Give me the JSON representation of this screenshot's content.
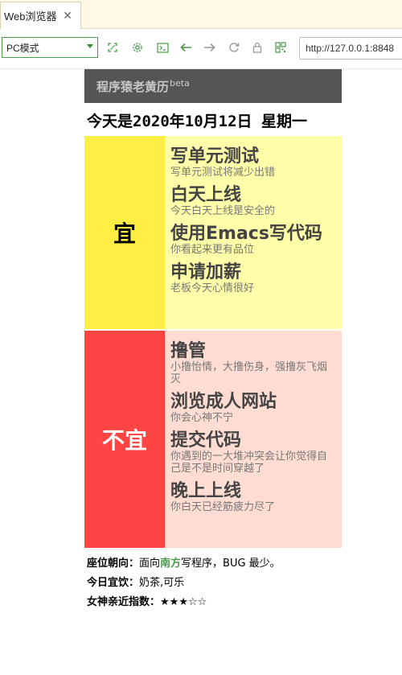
{
  "browser": {
    "tab": {
      "title": "Web浏览器",
      "close_glyph": "✕"
    },
    "mode_select": {
      "value": "PC模式"
    },
    "toolbar_icons": [
      "screenshot-icon",
      "settings-icon",
      "console-icon",
      "back-arrow-icon",
      "forward-arrow-icon",
      "reload-icon",
      "lock-icon",
      "qrcode-icon"
    ],
    "url": "http://127.0.0.1:8848",
    "accent_color": "#4a9a4a"
  },
  "page": {
    "header": {
      "title": "程序猿老黄历",
      "badge": "beta"
    },
    "date_line": "今天是2020年10月12日 星期一",
    "good": {
      "label": "宜",
      "color": "#ffee44",
      "items": [
        {
          "name": "写单元测试",
          "desc": "写单元测试将减少出错"
        },
        {
          "name": "白天上线",
          "desc": "今天白天上线是安全的"
        },
        {
          "name": "使用Emacs写代码",
          "desc": "你看起来更有品位"
        },
        {
          "name": "申请加薪",
          "desc": "老板今天心情很好"
        }
      ]
    },
    "bad": {
      "label": "不宜",
      "color": "#ff4444",
      "items": [
        {
          "name": "撸管",
          "desc": "小撸怡情，大撸伤身，强撸灰飞烟灭"
        },
        {
          "name": "浏览成人网站",
          "desc": "你会心神不宁"
        },
        {
          "name": "提交代码",
          "desc": "你遇到的一大堆冲突会让你觉得自己是不是时间穿越了"
        },
        {
          "name": "晚上上线",
          "desc": "你白天已经筋疲力尽了"
        }
      ]
    },
    "extras": {
      "seat_label": "座位朝向：",
      "seat_prefix": "面向",
      "seat_direction": "南方",
      "seat_suffix": "写程序，BUG 最少。",
      "drink_label": "今日宜饮：",
      "drink_value": "奶茶,可乐",
      "goddess_label": "女神亲近指数：",
      "goddess_stars": "★★★☆☆",
      "goddess_rating": 3,
      "goddess_max": 5
    }
  }
}
